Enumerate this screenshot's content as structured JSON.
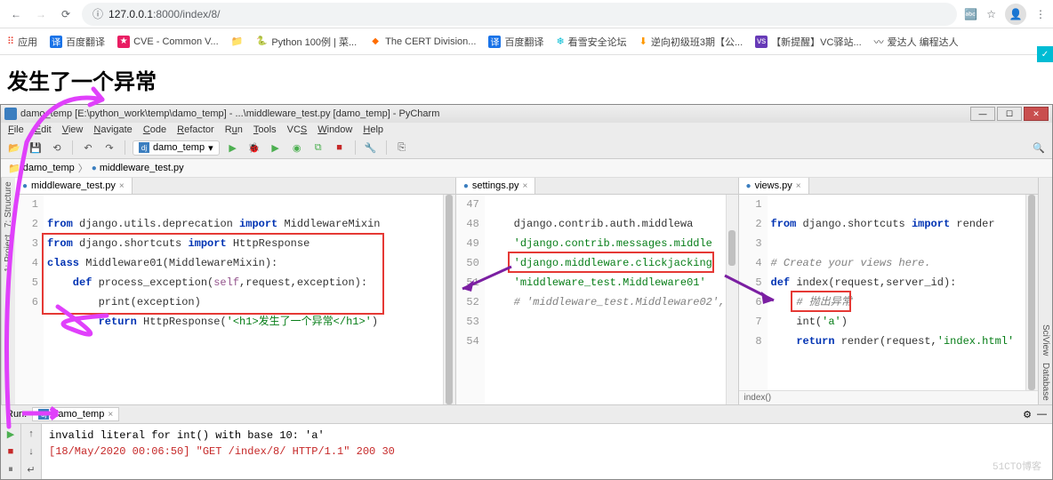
{
  "browser": {
    "url_host": "127.0.0.1",
    "url_path": ":8000/index/8/"
  },
  "bookmarks": {
    "apps": "应用",
    "baidu_translate": "百度翻译",
    "cve": "CVE - Common V...",
    "python100": "Python 100例 | 菜...",
    "cert": "The CERT Division...",
    "baidu_translate2": "百度翻译",
    "kanxue": "看雪安全论坛",
    "reverse": "逆向初级班3期【公...",
    "vc": "【新提醒】VC驿站...",
    "aidaren": "爱达人 编程达人"
  },
  "page": {
    "heading": "发生了一个异常"
  },
  "pycharm": {
    "title": "damo_temp [E:\\python_work\\temp\\damo_temp] - ...\\middleware_test.py [damo_temp] - PyCharm",
    "run_config": "damo_temp",
    "menu": {
      "file": "File",
      "edit": "Edit",
      "view": "View",
      "navigate": "Navigate",
      "code": "Code",
      "refactor": "Refactor",
      "run": "Run",
      "tools": "Tools",
      "vcs": "VCS",
      "window": "Window",
      "help": "Help"
    },
    "breadcrumb": {
      "root": "damo_temp",
      "file": "middleware_test.py"
    },
    "side": {
      "project": "1: Project",
      "structure": "7: Structure",
      "sciview": "SciView",
      "database": "Database"
    },
    "editors": {
      "middleware": {
        "tab": "middleware_test.py",
        "lines": [
          "1",
          "2",
          "3",
          "4",
          "5",
          "6"
        ],
        "l1a": "from ",
        "l1b": "django.utils.deprecation ",
        "l1c": "import ",
        "l1d": "MiddlewareMixin",
        "l2a": "from ",
        "l2b": "django.shortcuts ",
        "l2c": "import ",
        "l2d": "HttpResponse",
        "l3a": "class ",
        "l3b": "Middleware01(MiddlewareMixin):",
        "l4a": "    def ",
        "l4b": "process_exception(",
        "l4c": "self",
        "l4d": ",request,exception):",
        "l5a": "        print(exception)",
        "l6a": "        return ",
        "l6b": "HttpResponse(",
        "l6c": "'<h1>发生了一个异常</h1>'",
        "l6d": ")"
      },
      "settings": {
        "tab": "settings.py",
        "lines": [
          "47",
          "48",
          "49",
          "50",
          "51",
          "52",
          "53",
          "54"
        ],
        "l47": "    django.contrib.auth.middlewa",
        "l48a": "    '",
        "l48b": "django.contrib.messages.middle",
        "l49a": "    '",
        "l49b": "django.middleware.clickjacking",
        "l50a": "    '",
        "l50b": "middleware_test.Middleware01",
        "l50c": "'",
        "l51a": "    # '",
        "l51b": "middleware_test.Middleware02",
        "l51c": "',"
      },
      "views": {
        "tab": "views.py",
        "lines": [
          "1",
          "2",
          "3",
          "4",
          "5",
          "6",
          "7",
          "8"
        ],
        "l1a": "from ",
        "l1b": "django.shortcuts ",
        "l1c": "import ",
        "l1d": "render",
        "l3": "# Create your views here.",
        "l4a": "def ",
        "l4b": "index(request,server_id):",
        "l5": "    # 抛出异常",
        "l6a": "    int(",
        "l6b": "'a'",
        "l6c": ")",
        "l7a": "    return ",
        "l7b": "render(request,",
        "l7c": "'index.html'",
        "crumb": "index()"
      }
    },
    "run": {
      "label": "Run:",
      "tab": "damo_temp",
      "line1": "invalid literal for int() with base 10: 'a'",
      "line2": "[18/May/2020 00:06:50] \"GET /index/8/ HTTP/1.1\" 200 30"
    }
  },
  "watermark": "51CTO博客"
}
